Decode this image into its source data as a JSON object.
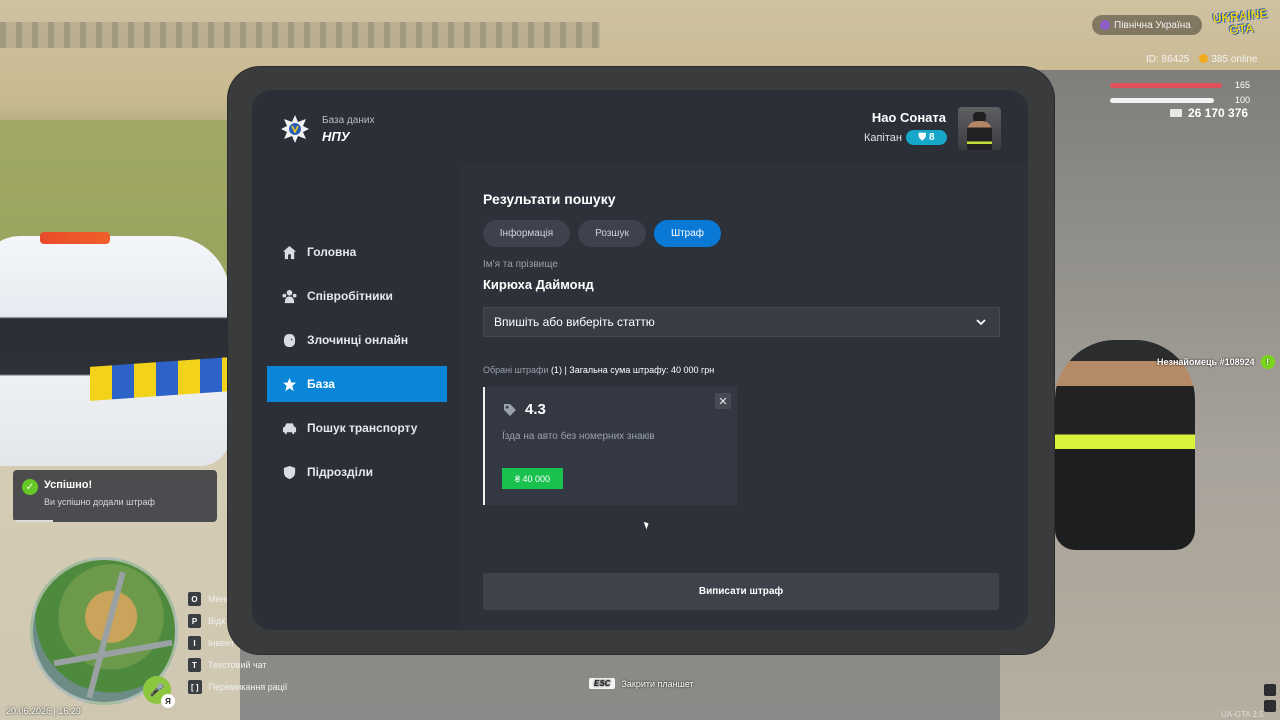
{
  "hud": {
    "server_name": "Північна Україна",
    "logo_line1": "UKRAINE",
    "logo_line2": "GTA",
    "player_id": "ID: 86425",
    "online": "385 online",
    "health": "165",
    "armor": "100",
    "money": "26 170 376",
    "nearby_player": "Незнайомець #108924",
    "datetime": "20.06.2026 | 16:29",
    "version": "UA-GTA 3.5",
    "voice_badge": "Я"
  },
  "notification": {
    "title": "Успішно!",
    "text": "Ви успішно додали штраф"
  },
  "hotkeys": [
    {
      "key": "O",
      "label": "Меню"
    },
    {
      "key": "P",
      "label": "Відк"
    },
    {
      "key": "I",
      "label": "Інвент"
    },
    {
      "key": "T",
      "label": "Текстовий чат"
    },
    {
      "key": "[ ]",
      "label": "Перемикання рації"
    }
  ],
  "esc_hint": {
    "key": "ESC",
    "label": "Закрити планшет"
  },
  "tablet": {
    "brand": {
      "subtitle": "База даних",
      "title": "НПУ"
    },
    "user": {
      "name": "Нао Соната",
      "rank": "Капітан",
      "level": "8"
    },
    "nav": [
      {
        "label": "Головна",
        "icon": "home-icon"
      },
      {
        "label": "Співробітники",
        "icon": "users-icon"
      },
      {
        "label": "Злочинці онлайн",
        "icon": "mask-icon"
      },
      {
        "label": "База",
        "icon": "star-icon",
        "active": true
      },
      {
        "label": "Пошук транспорту",
        "icon": "car-icon"
      },
      {
        "label": "Підрозділи",
        "icon": "shield-icon"
      }
    ],
    "section_title": "Результати пошуку",
    "tabs": [
      "Інформація",
      "Розшук",
      "Штраф"
    ],
    "active_tab": "Штраф",
    "name_label": "Ім'я та прізвище",
    "person_name": "Кирюха Даймонд",
    "article_select": "Впишіть або виберіть статтю",
    "summary_prefix": "Обрані штрафи",
    "summary_count": "(1)",
    "summary_total": "| Загальна сума штрафу: 40 000 грн",
    "fine": {
      "code": "4.3",
      "description": "Їзда на авто без номерних знаків",
      "amount": "₴ 40 000"
    },
    "issue_button": "Виписати штраф"
  },
  "colors": {
    "accent": "#0a86d8",
    "success": "#19c24f",
    "panel": "#2b2f38"
  }
}
